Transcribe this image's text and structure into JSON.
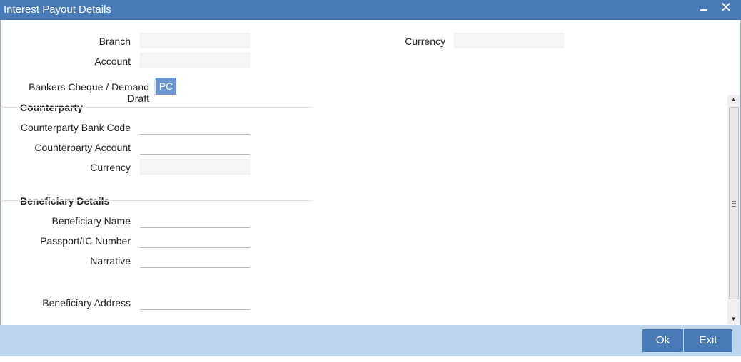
{
  "window": {
    "title": "Interest Payout Details",
    "minimize_icon": "minimize-icon",
    "close_icon": "close-icon",
    "close_glyph": "✕"
  },
  "header": {
    "branch_label": "Branch",
    "branch_value": "",
    "account_label": "Account",
    "account_value": "",
    "currency_label": "Currency",
    "currency_value": ""
  },
  "instrument": {
    "label": "Bankers Cheque / Demand Draft",
    "button_label": "PC"
  },
  "counterparty": {
    "title": "Counterparty",
    "bank_code_label": "Counterparty Bank Code",
    "bank_code_value": "",
    "account_label": "Counterparty Account",
    "account_value": "",
    "currency_label": "Currency",
    "currency_value": ""
  },
  "beneficiary": {
    "title": "Beneficiary Details",
    "name_label": "Beneficiary Name",
    "name_value": "",
    "passport_label": "Passport/IC Number",
    "passport_value": "",
    "narrative_label": "Narrative",
    "narrative_value": "",
    "address_label": "Beneficiary Address",
    "address_value": ""
  },
  "scrollbar": {
    "up_glyph": "▲",
    "down_glyph": "▼"
  },
  "footer": {
    "ok_label": "Ok",
    "exit_label": "Exit"
  },
  "colors": {
    "titlebar": "#4a79b8",
    "accent_button": "#6c95cf",
    "footer": "#bcd5ec"
  }
}
